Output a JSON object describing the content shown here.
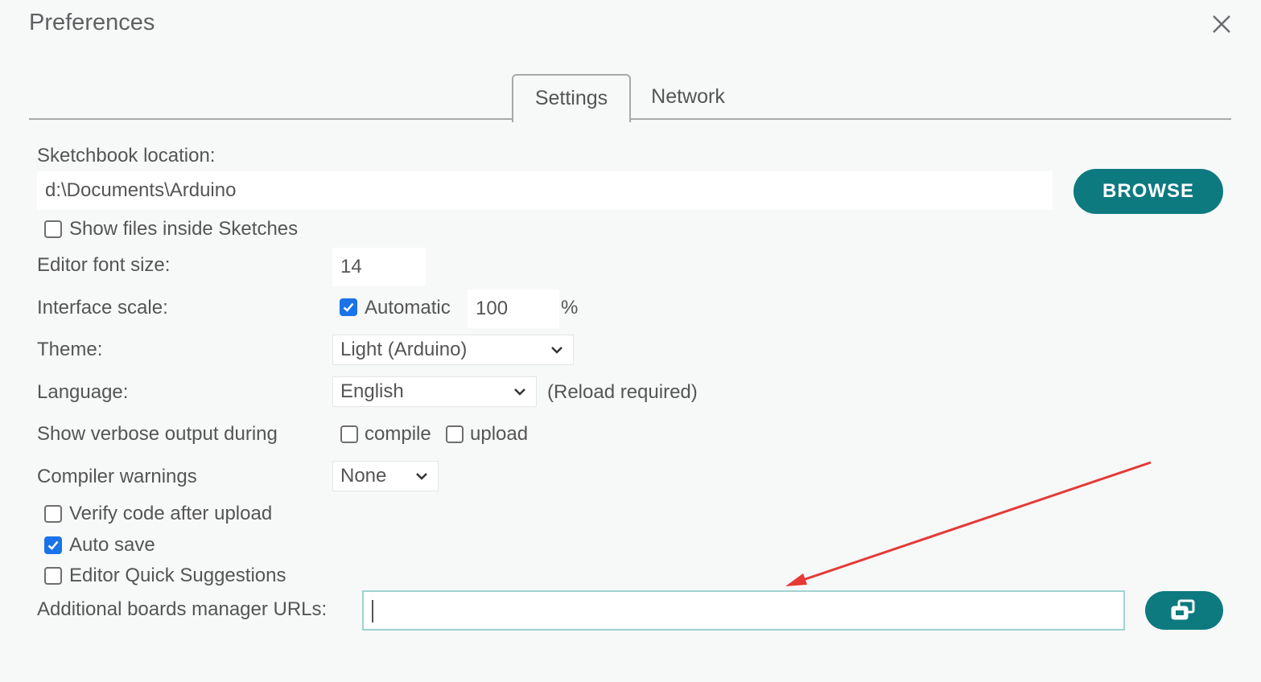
{
  "dialog": {
    "title": "Preferences",
    "close_icon": "close-icon"
  },
  "tabs": [
    {
      "label": "Settings",
      "active": true
    },
    {
      "label": "Network",
      "active": false
    }
  ],
  "settings": {
    "sketchbook_label": "Sketchbook location:",
    "sketchbook_value": "d:\\Documents\\Arduino",
    "browse_label": "BROWSE",
    "show_files_label": "Show files inside Sketches",
    "show_files_checked": false,
    "font_size_label": "Editor font size:",
    "font_size_value": "14",
    "interface_scale_label": "Interface scale:",
    "automatic_label": "Automatic",
    "automatic_checked": true,
    "scale_value": "100",
    "scale_unit": "%",
    "theme_label": "Theme:",
    "theme_value": "Light (Arduino)",
    "language_label": "Language:",
    "language_value": "English",
    "reload_note": "(Reload required)",
    "verbose_label": "Show verbose output during",
    "compile_label": "compile",
    "compile_checked": false,
    "upload_label": "upload",
    "upload_checked": false,
    "compiler_warnings_label": "Compiler warnings",
    "compiler_warnings_value": "None",
    "verify_label": "Verify code after upload",
    "verify_checked": false,
    "auto_save_label": "Auto save",
    "auto_save_checked": true,
    "quick_suggestions_label": "Editor Quick Suggestions",
    "quick_suggestions_checked": false,
    "boards_urls_label": "Additional boards manager URLs:",
    "boards_urls_value": "",
    "boards_urls_button_icon": "open-window-icon"
  },
  "colors": {
    "accent": "#0d7a80",
    "checkbox_checked": "#1a73e8",
    "annotation_arrow": "#e53935"
  }
}
